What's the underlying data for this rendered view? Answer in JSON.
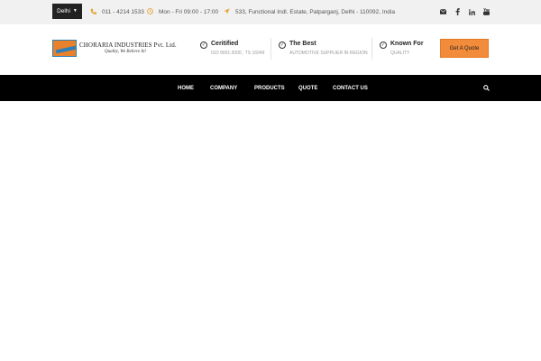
{
  "topbar": {
    "city": "Delhi",
    "phone": "011 - 4214 1533",
    "hours": "Mon - Fri 09:00 - 17:00",
    "address": "533, Functional Indl. Estate, Patparganj, Delhi - 110092, India",
    "social": [
      "envelope-icon",
      "facebook-icon",
      "linkedin-icon",
      "youtube-icon"
    ]
  },
  "logo": {
    "name": "CHORARIA INDUSTRIES Pvt. Ltd.",
    "tagline": "Quality, We Believe In!"
  },
  "features": [
    {
      "title": "Ceritified",
      "subtitle": "ISO 9001:2000 , TS 16949"
    },
    {
      "title": "The Best",
      "subtitle": "AUTOMOTIVE SUPPLIER IN REGION"
    },
    {
      "title": "Known For",
      "subtitle": "QUALITY"
    }
  ],
  "header": {
    "quote_button": "Get A Quote"
  },
  "nav": {
    "items": [
      "HOME",
      "COMPANY",
      "PRODUCTS",
      "QUOTE",
      "CONTACT US"
    ]
  },
  "colors": {
    "accent": "#f28b3a",
    "topbar_bg": "#f1f1f1",
    "nav_bg": "#000000",
    "icon_accent": "#e7a23a"
  }
}
